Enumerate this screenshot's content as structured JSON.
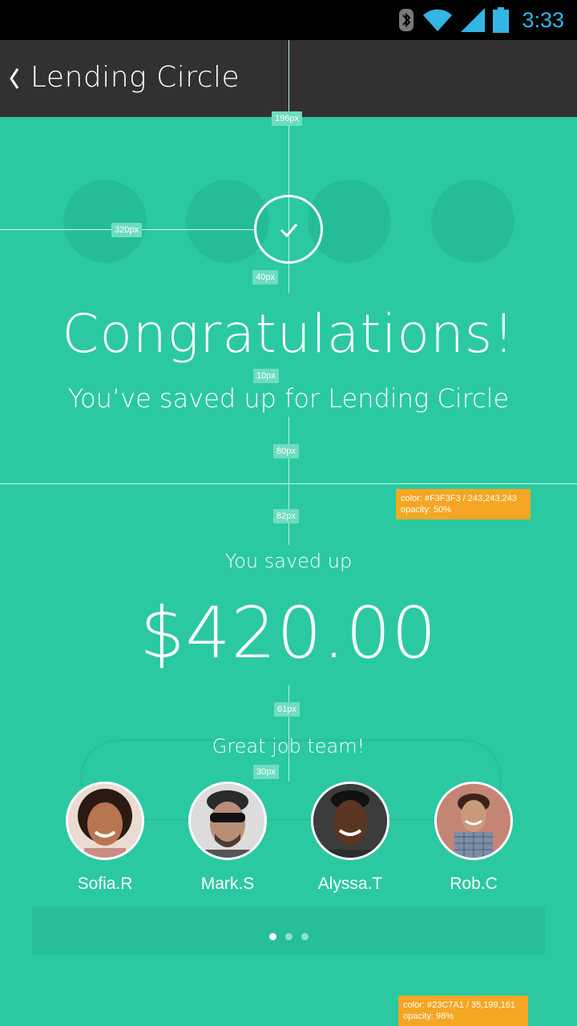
{
  "status": {
    "time": "3:33"
  },
  "appbar": {
    "title": "Lending Circle"
  },
  "hero": {
    "title": "Congratulations!",
    "subtitle": "You’ve saved up for Lending Circle"
  },
  "savings": {
    "label": "You saved up",
    "amount": "$420.00"
  },
  "team": {
    "message": "Great job team!",
    "members": [
      {
        "name": "Sofia.R"
      },
      {
        "name": "Mark.S"
      },
      {
        "name": "Alyssa.T"
      },
      {
        "name": "Rob.C"
      }
    ]
  },
  "pager": {
    "count": 3,
    "active": 0
  },
  "redlines": {
    "tag_196": "196px",
    "tag_320": "320px",
    "tag_40": "40px",
    "tag_10": "10px",
    "tag_80": "80px",
    "tag_82": "82px",
    "tag_61": "61px",
    "tag_30": "30px",
    "note_text_line1": "color: #F3F3F3 / 243,243,243",
    "note_text_line2": "opacity: 50%",
    "note_bg_line1": "color: #23C7A1 / 35,199,161",
    "note_bg_line2": "opacity: 98%"
  },
  "colors": {
    "accent": "#2BC9A1",
    "appbar": "#323033",
    "note": "#F5A623"
  }
}
